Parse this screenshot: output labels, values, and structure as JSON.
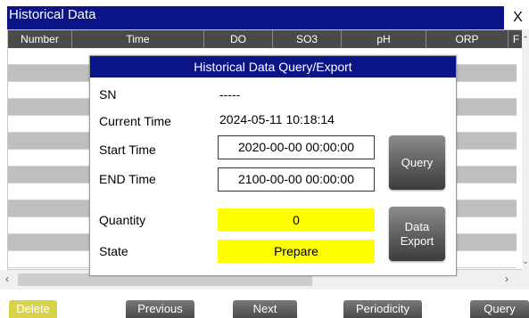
{
  "window": {
    "title": "Historical Data",
    "close_label": "X"
  },
  "table": {
    "columns": [
      "Number",
      "Time",
      "DO",
      "SO3",
      "pH",
      "ORP",
      "F"
    ]
  },
  "dialog": {
    "title": "Historical Data Query/Export",
    "sn_label": "SN",
    "sn_value": "-----",
    "current_time_label": "Current Time",
    "current_time_value": "2024-05-11 10:18:14",
    "start_time_label": "Start Time",
    "start_time_value": "2020-00-00 00:00:00",
    "end_time_label": "END Time",
    "end_time_value": "2100-00-00 00:00:00",
    "quantity_label": "Quantity",
    "quantity_value": "0",
    "state_label": "State",
    "state_value": "Prepare",
    "query_button": "Query",
    "export_button_line1": "Data",
    "export_button_line2": "Export"
  },
  "bottom_buttons": {
    "delete": "Delete",
    "previous": "Previous",
    "next": "Next",
    "periodicity": "Periodicity",
    "query": "Query"
  },
  "colors": {
    "title_blue": "#0a1486",
    "header_gray": "#4a4a4a",
    "row_gray": "#bfbfbf",
    "highlight_yellow": "#ffff00",
    "delete_yellow": "#d9d34a"
  }
}
